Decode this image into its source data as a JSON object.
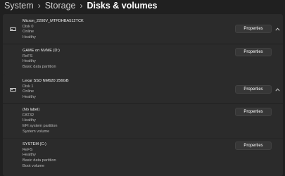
{
  "breadcrumb": [
    "System",
    "Storage",
    "Disks & volumes"
  ],
  "disks": [
    {
      "lines": [
        "Micron_2200V_MTFDHBA512TCK",
        "Disk 0",
        "Online",
        "Healthy"
      ],
      "button_label": "Properties",
      "volumes": [
        {
          "lines": [
            "GAME on NVME (D:)",
            "ReFS",
            "Healthy",
            "Basic data partition"
          ],
          "button_label": "Properties"
        }
      ]
    },
    {
      "lines": [
        "Lexar SSD NM620 256GB",
        "Disk 1",
        "Online",
        "Healthy"
      ],
      "button_label": "Properties",
      "volumes": [
        {
          "lines": [
            "(No label)",
            "FAT32",
            "Healthy",
            "EFI system partition",
            "System volume"
          ],
          "button_label": "Properties"
        },
        {
          "lines": [
            "SYSTEM (C:)",
            "ReFS",
            "Healthy",
            "Basic data partition",
            "Boot volume"
          ],
          "button_label": "Properties"
        }
      ]
    }
  ]
}
